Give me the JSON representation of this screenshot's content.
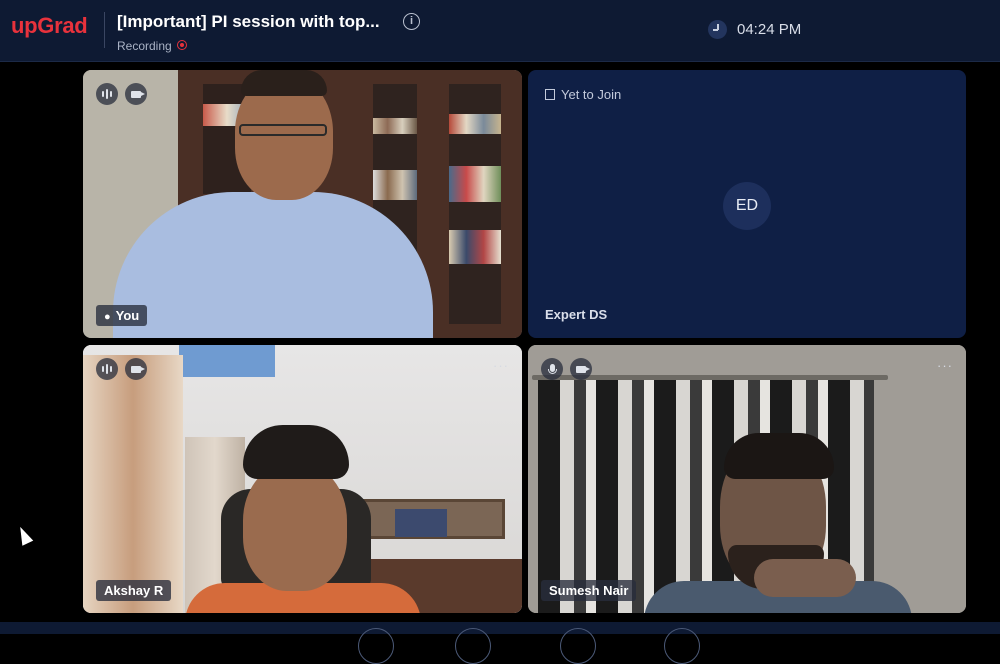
{
  "header": {
    "logo": "upGrad",
    "title": "[Important] PI session with top...",
    "recording_label": "Recording",
    "info_icon": "i",
    "time": "04:24 PM"
  },
  "tiles": {
    "you": {
      "name": "You"
    },
    "expert": {
      "status": "Yet to Join",
      "initials": "ED",
      "name": "Expert DS"
    },
    "akshay": {
      "name": "Akshay R"
    },
    "sumesh": {
      "name": "Sumesh Nair"
    }
  },
  "more_glyph": "···",
  "colors": {
    "brand": "#e8323c",
    "topbar": "#0e1a33",
    "expert_tile": "#0f1f45"
  }
}
